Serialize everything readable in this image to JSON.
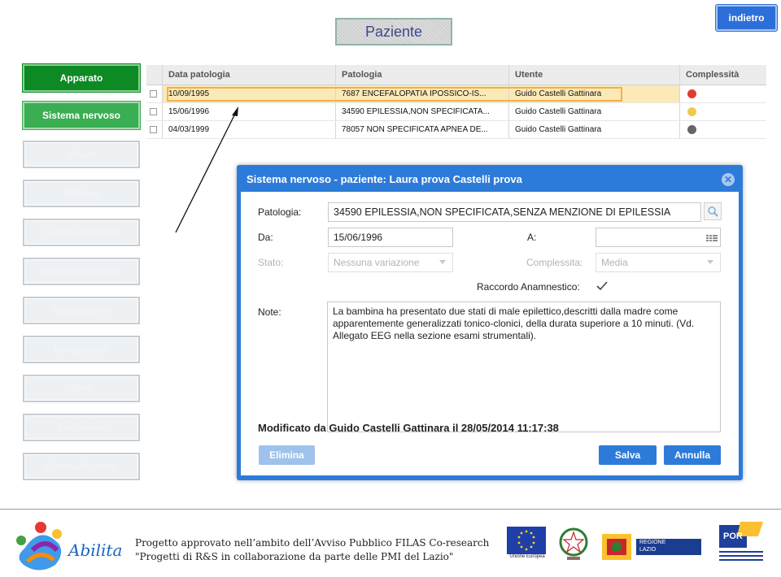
{
  "header": {
    "title": "Paziente",
    "back_label": "indietro"
  },
  "nav": [
    {
      "label": "Apparato",
      "state": "active"
    },
    {
      "label": "Sistema nervoso",
      "state": "selected"
    },
    {
      "label": "Visivo",
      "state": "normal"
    },
    {
      "label": "Uditivo",
      "state": "normal"
    },
    {
      "label": "Cardiovascolare",
      "state": "normal"
    },
    {
      "label": "Gastrointestinale",
      "state": "normal"
    },
    {
      "label": "Respiratorio",
      "state": "normal"
    },
    {
      "label": "Urogenitale",
      "state": "normal"
    },
    {
      "label": "Altro",
      "state": "normal"
    },
    {
      "label": "Endocrino",
      "state": "normal"
    },
    {
      "label": "Osteoarticolare",
      "state": "normal"
    }
  ],
  "table": {
    "columns": [
      "Data patologia",
      "Patologia",
      "Utente",
      "Complessità"
    ],
    "rows": [
      {
        "date": "10/09/1995",
        "pathology": "7687 ENCEFALOPATIA IPOSSICO-IS...",
        "user": "Guido Castelli Gattinara",
        "complexity_color": "#e23b2e"
      },
      {
        "date": "15/06/1996",
        "pathology": "34590 EPILESSIA,NON SPECIFICATA...",
        "user": "Guido Castelli Gattinara",
        "complexity_color": "#f2c94c"
      },
      {
        "date": "04/03/1999",
        "pathology": "78057 NON SPECIFICATA APNEA DE...",
        "user": "Guido Castelli Gattinara",
        "complexity_color": "#666666"
      }
    ]
  },
  "dialog": {
    "title": "Sistema nervoso - paziente: Laura prova Castelli prova",
    "patologia_label": "Patologia:",
    "patologia_value": "34590 EPILESSIA,NON SPECIFICATA,SENZA MENZIONE DI EPILESSIA",
    "da_label": "Da:",
    "da_value": "15/06/1996",
    "a_label": "A:",
    "a_value": "",
    "stato_label": "Stato:",
    "stato_value": "Nessuna variazione",
    "complessita_label": "Complessita:",
    "complessita_value": "Media",
    "raccordo_label": "Raccordo Anamnestico:",
    "raccordo_checked": true,
    "note_label": "Note:",
    "note_value": "La bambina ha  presentato due stati di male epilettico,descritti dalla madre come apparentemente generalizzati tonico-clonici, della durata superiore a 10 minuti. (Vd. Allegato EEG nella sezione esami strumentali).",
    "modified_text": "Modificato da Guido Castelli Gattinara il 28/05/2014 11:17:38",
    "delete_label": "Elimina",
    "save_label": "Salva",
    "cancel_label": "Annulla"
  },
  "footer": {
    "line1": "Progetto approvato nell’ambito dell’Avviso Pubblico FILAS Co-research",
    "line2": "\"Progetti di R&S in collaborazione da parte delle PMI del Lazio\"",
    "brand": "Abilita",
    "ue_label": "Unione Europea",
    "regione_label1": "REGIONE",
    "regione_label2": "LAZIO",
    "por_label": "POR"
  }
}
